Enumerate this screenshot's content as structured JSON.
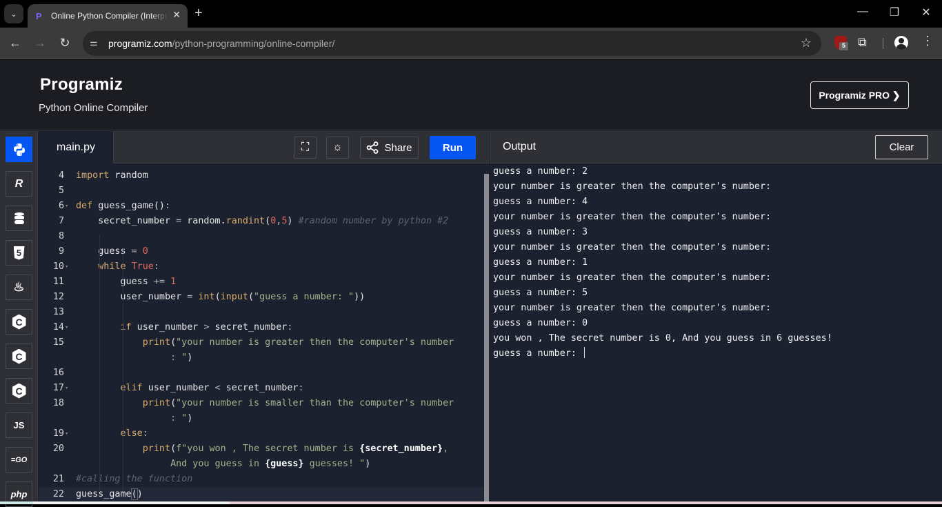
{
  "browser": {
    "tab_title": "Online Python Compiler (Interpreter)",
    "new_tab_icon": "plus-icon",
    "url_domain": "programiz.com",
    "url_path": "/python-programming/online-compiler/",
    "extension_badge": "5"
  },
  "header": {
    "logo": "Programiz",
    "subtitle": "Python Online Compiler",
    "pro_button": "Programiz PRO ❯"
  },
  "languages": [
    {
      "name": "python",
      "label": "",
      "active": true
    },
    {
      "name": "r",
      "label": "R"
    },
    {
      "name": "sql",
      "label": ""
    },
    {
      "name": "html",
      "label": "5"
    },
    {
      "name": "java",
      "label": "♨"
    },
    {
      "name": "c",
      "label": "C"
    },
    {
      "name": "cpp",
      "label": "C"
    },
    {
      "name": "csharp",
      "label": "C"
    },
    {
      "name": "javascript",
      "label": "JS"
    },
    {
      "name": "go",
      "label": "=GO"
    },
    {
      "name": "php",
      "label": "php"
    }
  ],
  "editor": {
    "file_tab": "main.py",
    "share_label": "Share",
    "run_label": "Run",
    "lines": [
      {
        "num": "4",
        "text": "import random"
      },
      {
        "num": "5",
        "text": ""
      },
      {
        "num": "6",
        "text": "def guess_game():",
        "fold": true
      },
      {
        "num": "7",
        "text": "    secret_number = random.randint(0,5) #random number by python #2"
      },
      {
        "num": "8",
        "text": ""
      },
      {
        "num": "9",
        "text": "    guess = 0"
      },
      {
        "num": "10",
        "text": "    while True:",
        "fold": true
      },
      {
        "num": "11",
        "text": "        guess += 1"
      },
      {
        "num": "12",
        "text": "        user_number = int(input(\"guess a number: \"))"
      },
      {
        "num": "13",
        "text": ""
      },
      {
        "num": "14",
        "text": "        if user_number > secret_number:",
        "fold": true
      },
      {
        "num": "15",
        "text": "            print(\"your number is greater then the computer's number : \")"
      },
      {
        "num": "16",
        "text": ""
      },
      {
        "num": "17",
        "text": "        elif user_number < secret_number:",
        "fold": true
      },
      {
        "num": "18",
        "text": "            print(\"your number is smaller than the computer's number : \")"
      },
      {
        "num": "19",
        "text": "        else:",
        "fold": true
      },
      {
        "num": "20",
        "text": "            print(f\"you won , The secret number is {secret_number}, And you guess in {guess} guesses! \")"
      },
      {
        "num": "21",
        "text": "#calling the function"
      },
      {
        "num": "22",
        "text": "guess_game()"
      }
    ]
  },
  "output": {
    "title": "Output",
    "clear_label": "Clear",
    "lines": [
      "guess a number: 2",
      "your number is greater then the computer's number:",
      "guess a number: 4",
      "your number is greater then the computer's number:",
      "guess a number: 3",
      "your number is greater then the computer's number:",
      "guess a number: 1",
      "your number is greater then the computer's number:",
      "guess a number: 5",
      "your number is greater then the computer's number:",
      "guess a number: 0",
      "you won , The secret number is 0, And you guess in 6 guesses!",
      "guess a number: "
    ]
  }
}
